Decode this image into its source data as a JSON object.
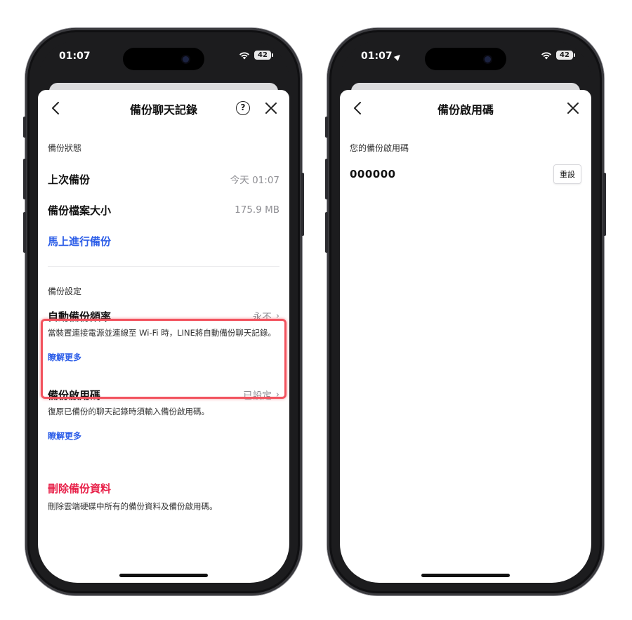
{
  "status_bar": {
    "time": "01:07",
    "battery": "42"
  },
  "left_screen": {
    "title": "備份聊天記錄",
    "help_glyph": "?",
    "backup_status": {
      "heading": "備份狀態",
      "last_backup_label": "上次備份",
      "last_backup_value": "今天 01:07",
      "size_label": "備份檔案大小",
      "size_value": "175.9 MB",
      "backup_now": "馬上進行備份"
    },
    "backup_settings": {
      "heading": "備份設定",
      "auto_label": "自動備份頻率",
      "auto_value": "永不",
      "auto_desc": "當裝置連接電源並連線至 Wi-Fi 時，LINE將自動備份聊天記錄。",
      "auto_more": "瞭解更多",
      "pin_label": "備份啟用碼",
      "pin_value": "已設定",
      "pin_desc": "復原已備份的聊天記錄時須輸入備份啟用碼。",
      "pin_more": "瞭解更多"
    },
    "delete": {
      "label": "刪除備份資料",
      "desc": "刪除雲端硬碟中所有的備份資料及備份啟用碼。"
    }
  },
  "right_screen": {
    "title": "備份啟用碼",
    "code_label": "您的備份啟用碼",
    "code_value": "000000",
    "reset_label": "重設"
  },
  "colors": {
    "link": "#2d5ee8",
    "danger": "#e8224a",
    "highlight": "#f2535e"
  }
}
